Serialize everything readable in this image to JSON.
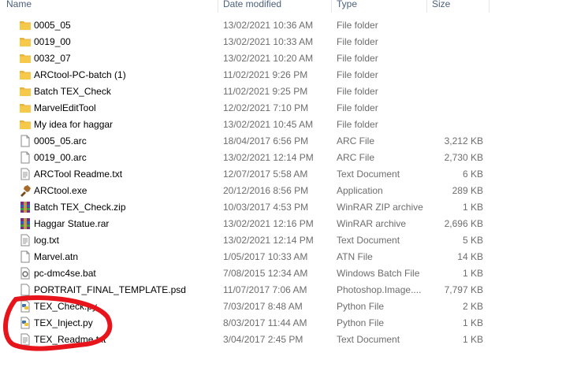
{
  "columns": {
    "name": "Name",
    "date": "Date modified",
    "type": "Type",
    "size": "Size"
  },
  "files": [
    {
      "name": "0005_05",
      "date": "13/02/2021 10:36 AM",
      "type": "File folder",
      "size": "",
      "icon": "folder-icon"
    },
    {
      "name": "0019_00",
      "date": "13/02/2021 10:33 AM",
      "type": "File folder",
      "size": "",
      "icon": "folder-icon"
    },
    {
      "name": "0032_07",
      "date": "13/02/2021 10:20 AM",
      "type": "File folder",
      "size": "",
      "icon": "folder-icon"
    },
    {
      "name": "ARCtool-PC-batch (1)",
      "date": "11/02/2021 9:26 PM",
      "type": "File folder",
      "size": "",
      "icon": "folder-icon"
    },
    {
      "name": "Batch TEX_Check",
      "date": "11/02/2021 9:25 PM",
      "type": "File folder",
      "size": "",
      "icon": "folder-icon"
    },
    {
      "name": "MarvelEditTool",
      "date": "12/02/2021 7:10 PM",
      "type": "File folder",
      "size": "",
      "icon": "folder-icon"
    },
    {
      "name": "My idea for haggar",
      "date": "13/02/2021 10:45 AM",
      "type": "File folder",
      "size": "",
      "icon": "folder-icon"
    },
    {
      "name": "0005_05.arc",
      "date": "18/04/2017 6:56 PM",
      "type": "ARC File",
      "size": "3,212 KB",
      "icon": "blank-file-icon"
    },
    {
      "name": "0019_00.arc",
      "date": "13/02/2021 12:14 PM",
      "type": "ARC File",
      "size": "2,730 KB",
      "icon": "blank-file-icon"
    },
    {
      "name": "ARCTool Readme.txt",
      "date": "12/07/2017 5:58 AM",
      "type": "Text Document",
      "size": "6 KB",
      "icon": "text-file-icon"
    },
    {
      "name": "ARCtool.exe",
      "date": "20/12/2016 8:56 PM",
      "type": "Application",
      "size": "289 KB",
      "icon": "app-icon"
    },
    {
      "name": "Batch TEX_Check.zip",
      "date": "10/03/2017 4:53 PM",
      "type": "WinRAR ZIP archive",
      "size": "1 KB",
      "icon": "winrar-icon"
    },
    {
      "name": "Haggar Statue.rar",
      "date": "13/02/2021 12:16 PM",
      "type": "WinRAR archive",
      "size": "2,696 KB",
      "icon": "winrar-icon"
    },
    {
      "name": "log.txt",
      "date": "13/02/2021 12:14 PM",
      "type": "Text Document",
      "size": "5 KB",
      "icon": "text-file-icon"
    },
    {
      "name": "Marvel.atn",
      "date": "1/05/2017 10:33 AM",
      "type": "ATN File",
      "size": "14 KB",
      "icon": "blank-file-icon"
    },
    {
      "name": "pc-dmc4se.bat",
      "date": "7/08/2015 12:34 AM",
      "type": "Windows Batch File",
      "size": "1 KB",
      "icon": "batch-file-icon"
    },
    {
      "name": "PORTRAIT_FINAL_TEMPLATE.psd",
      "date": "11/07/2017 7:06 AM",
      "type": "Photoshop.Image....",
      "size": "7,797 KB",
      "icon": "photoshop-icon"
    },
    {
      "name": "TEX_Check.py",
      "date": "7/03/2017 8:48 AM",
      "type": "Python File",
      "size": "2 KB",
      "icon": "python-icon"
    },
    {
      "name": "TEX_Inject.py",
      "date": "8/03/2017 11:44 AM",
      "type": "Python File",
      "size": "1 KB",
      "icon": "python-icon"
    },
    {
      "name": "TEX_Readme.txt",
      "date": "3/04/2017 2:45 PM",
      "type": "Text Document",
      "size": "1 KB",
      "icon": "text-file-icon"
    }
  ],
  "colors": {
    "header_text": "#4c607a",
    "secondary_text": "#6d6d6d",
    "folder": "#f7c94b",
    "annotation": "#e8141c"
  }
}
